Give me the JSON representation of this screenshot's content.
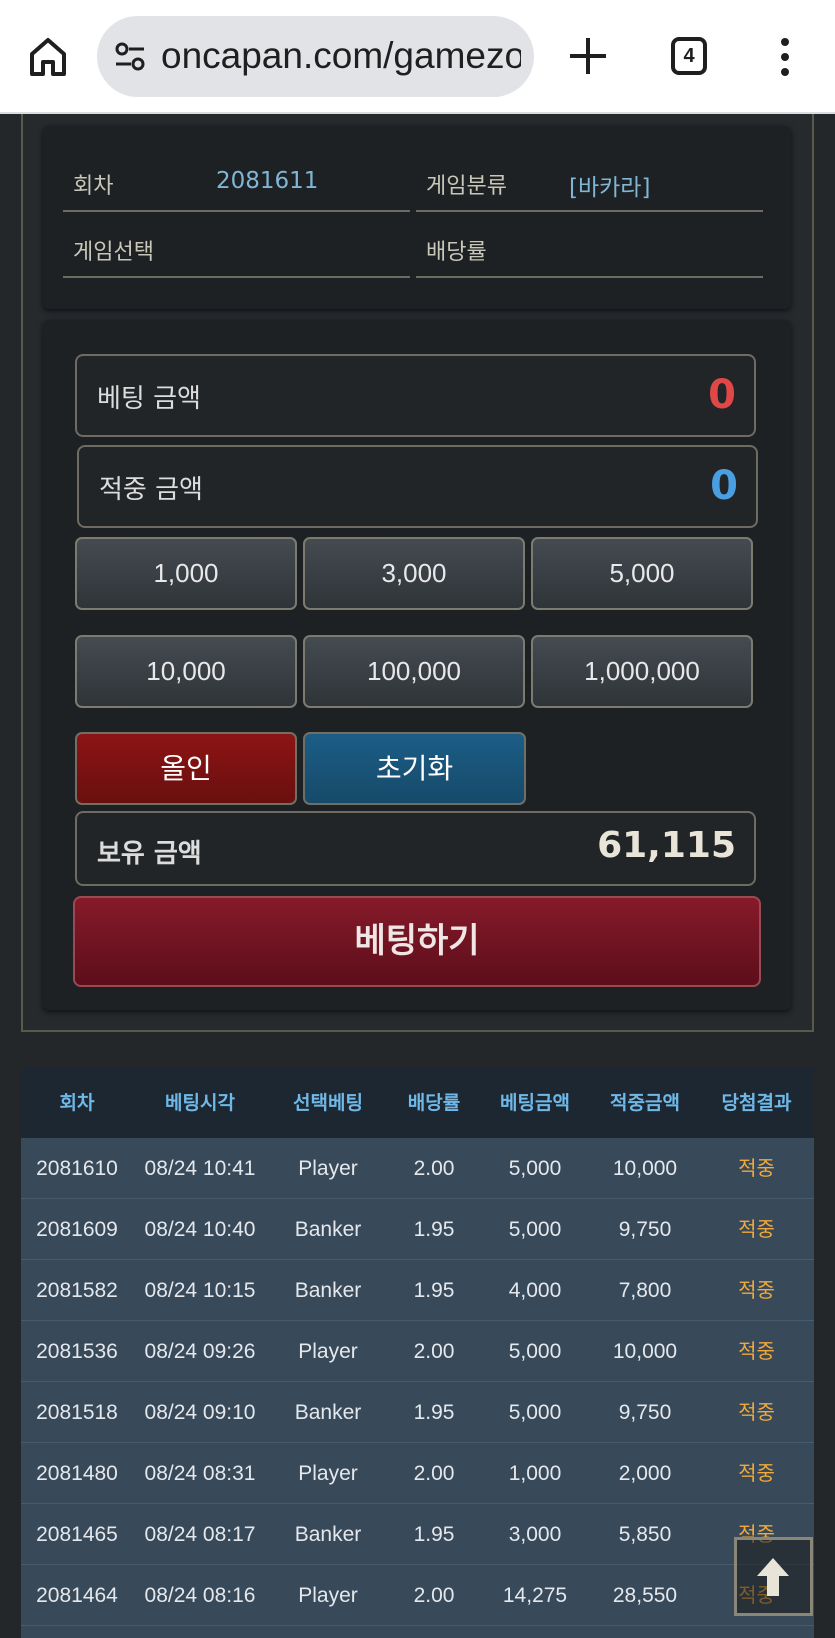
{
  "browser": {
    "url": "oncapan.com/gamezone",
    "tab_count": "4"
  },
  "round_info": {
    "round_label": "회차",
    "round_value": "2081611",
    "category_label": "게임분류",
    "category_value": "[바카라]",
    "selection_label": "게임선택",
    "selection_value": "",
    "odds_label": "배당률",
    "odds_value": ""
  },
  "bet_panel": {
    "bet_amount_label": "베팅 금액",
    "bet_amount_value": "0",
    "win_amount_label": "적중 금액",
    "win_amount_value": "0",
    "chips": [
      "1,000",
      "3,000",
      "5,000",
      "10,000",
      "100,000",
      "1,000,000"
    ],
    "allin_label": "올인",
    "reset_label": "초기화",
    "balance_label": "보유 금액",
    "balance_value": "61,115",
    "submit_label": "베팅하기",
    "colors": {
      "bet_value": "#e04848",
      "win_value": "#4a9fe0"
    }
  },
  "history": {
    "columns": [
      "회차",
      "베팅시각",
      "선택베팅",
      "배당률",
      "베팅금액",
      "적중금액",
      "당첨결과"
    ],
    "rows": [
      [
        "2081610",
        "08/24 10:41",
        "Player",
        "2.00",
        "5,000",
        "10,000",
        "적중"
      ],
      [
        "2081609",
        "08/24 10:40",
        "Banker",
        "1.95",
        "5,000",
        "9,750",
        "적중"
      ],
      [
        "2081582",
        "08/24 10:15",
        "Banker",
        "1.95",
        "4,000",
        "7,800",
        "적중"
      ],
      [
        "2081536",
        "08/24 09:26",
        "Player",
        "2.00",
        "5,000",
        "10,000",
        "적중"
      ],
      [
        "2081518",
        "08/24 09:10",
        "Banker",
        "1.95",
        "5,000",
        "9,750",
        "적중"
      ],
      [
        "2081480",
        "08/24 08:31",
        "Player",
        "2.00",
        "1,000",
        "2,000",
        "적중"
      ],
      [
        "2081465",
        "08/24 08:17",
        "Banker",
        "1.95",
        "3,000",
        "5,850",
        "적중"
      ],
      [
        "2081464",
        "08/24 08:16",
        "Player",
        "2.00",
        "14,275",
        "28,550",
        "적중"
      ]
    ]
  }
}
